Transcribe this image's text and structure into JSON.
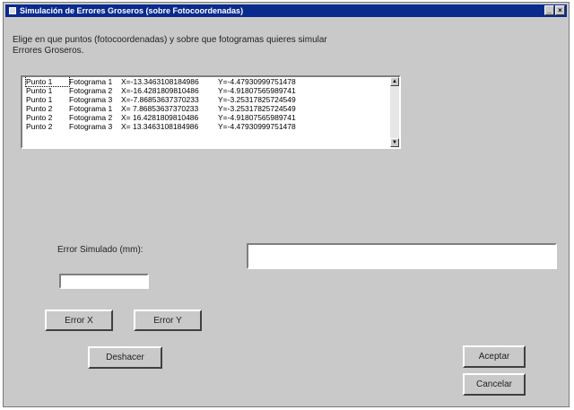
{
  "window": {
    "title": "Simulación de Errores Groseros (sobre Fotocoordenadas)",
    "minimize_label": "_",
    "close_label": "×"
  },
  "instructions": "Elige en que puntos (fotocoordenadas) y sobre que fotogramas quieres simular Errores Groseros.",
  "list": {
    "rows": [
      {
        "punto": "Punto 1",
        "foto": "Fotograma 1",
        "x": "X=-13.3463108184986",
        "y": "Y=-4.47930999751478"
      },
      {
        "punto": "Punto 1",
        "foto": "Fotograma 2",
        "x": "X=-16.4281809810486",
        "y": "Y=-4.91807565989741"
      },
      {
        "punto": "Punto 1",
        "foto": "Fotograma 3",
        "x": "X=-7.86853637370233",
        "y": "Y=-3.25317825724549"
      },
      {
        "punto": "Punto 2",
        "foto": "Fotograma 1",
        "x": "X= 7.86853637370233",
        "y": "Y=-3.25317825724549"
      },
      {
        "punto": "Punto 2",
        "foto": "Fotograma 2",
        "x": "X= 16.4281809810486",
        "y": "Y=-4.91807565989741"
      },
      {
        "punto": "Punto 2",
        "foto": "Fotograma 3",
        "x": "X= 13.3463108184986",
        "y": "Y=-4.47930999751478"
      }
    ],
    "scroll_up_icon": "▲",
    "scroll_down_icon": "▼"
  },
  "error_label": "Error Simulado (mm):",
  "error_input": {
    "value": ""
  },
  "result_field": {
    "value": ""
  },
  "buttons": {
    "error_x": "Error X",
    "error_y": "Error Y",
    "deshacer": "Deshacer",
    "aceptar": "Aceptar",
    "cancelar": "Cancelar"
  }
}
